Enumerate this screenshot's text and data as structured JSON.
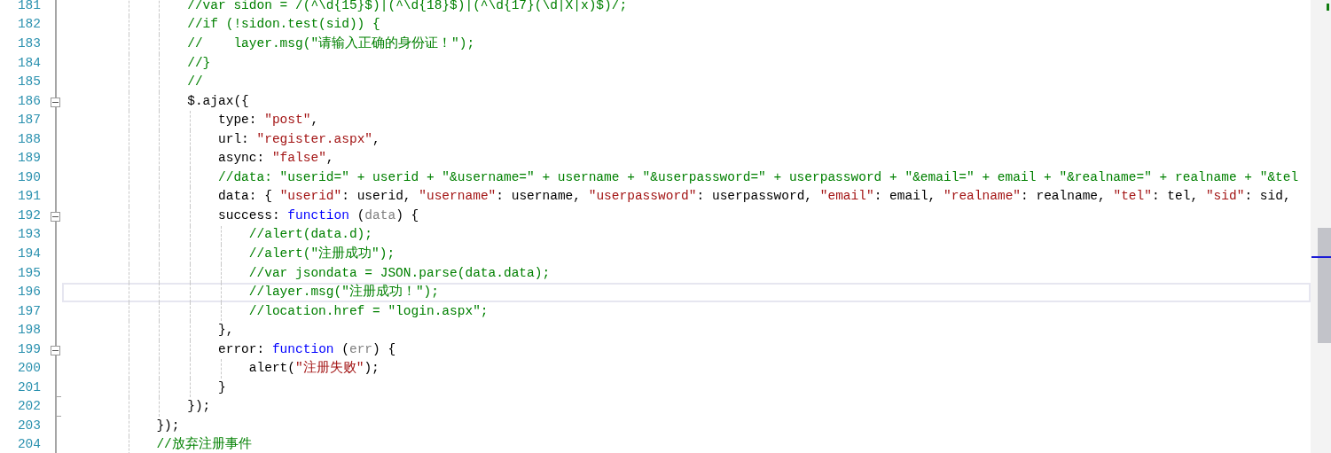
{
  "editor": {
    "lines": [
      {
        "number": "181",
        "current": false,
        "tokens": [
          {
            "kind": "comment",
            "text": "                //var sidon = /(^\\d{15}$)|(^\\d{18}$)|(^\\d{17}(\\d|X|x)$)/;"
          }
        ]
      },
      {
        "number": "182",
        "current": false,
        "tokens": [
          {
            "kind": "comment",
            "text": "                //if (!sidon.test(sid)) {"
          }
        ]
      },
      {
        "number": "183",
        "current": false,
        "tokens": [
          {
            "kind": "comment",
            "text": "                //    layer.msg(\"请输入正确的身份证！\");"
          }
        ]
      },
      {
        "number": "184",
        "current": false,
        "tokens": [
          {
            "kind": "comment",
            "text": "                //}"
          }
        ]
      },
      {
        "number": "185",
        "current": false,
        "tokens": [
          {
            "kind": "comment",
            "text": "                //"
          }
        ]
      },
      {
        "number": "186",
        "collapsible": true,
        "current": false,
        "tokens": [
          {
            "kind": "plain",
            "text": "                $.ajax({"
          }
        ]
      },
      {
        "number": "187",
        "current": false,
        "tokens": [
          {
            "kind": "plain",
            "text": "                    type: "
          },
          {
            "kind": "string",
            "text": "\"post\""
          },
          {
            "kind": "plain",
            "text": ","
          }
        ]
      },
      {
        "number": "188",
        "current": false,
        "tokens": [
          {
            "kind": "plain",
            "text": "                    url: "
          },
          {
            "kind": "string",
            "text": "\"register.aspx\""
          },
          {
            "kind": "plain",
            "text": ","
          }
        ]
      },
      {
        "number": "189",
        "current": false,
        "tokens": [
          {
            "kind": "plain",
            "text": "                    async: "
          },
          {
            "kind": "string",
            "text": "\"false\""
          },
          {
            "kind": "plain",
            "text": ","
          }
        ]
      },
      {
        "number": "190",
        "current": false,
        "tokens": [
          {
            "kind": "comment",
            "text": "                    //data: \"userid=\" + userid + \"&username=\" + username + \"&userpassword=\" + userpassword + \"&email=\" + email + \"&realname=\" + realname + \"&tel"
          }
        ]
      },
      {
        "number": "191",
        "current": false,
        "tokens": [
          {
            "kind": "plain",
            "text": "                    data: { "
          },
          {
            "kind": "string",
            "text": "\"userid\""
          },
          {
            "kind": "plain",
            "text": ": userid, "
          },
          {
            "kind": "string",
            "text": "\"username\""
          },
          {
            "kind": "plain",
            "text": ": username, "
          },
          {
            "kind": "string",
            "text": "\"userpassword\""
          },
          {
            "kind": "plain",
            "text": ": userpassword, "
          },
          {
            "kind": "string",
            "text": "\"email\""
          },
          {
            "kind": "plain",
            "text": ": email, "
          },
          {
            "kind": "string",
            "text": "\"realname\""
          },
          {
            "kind": "plain",
            "text": ": realname, "
          },
          {
            "kind": "string",
            "text": "\"tel\""
          },
          {
            "kind": "plain",
            "text": ": tel, "
          },
          {
            "kind": "string",
            "text": "\"sid\""
          },
          {
            "kind": "plain",
            "text": ": sid,"
          }
        ]
      },
      {
        "number": "192",
        "collapsible": true,
        "current": false,
        "tokens": [
          {
            "kind": "plain",
            "text": "                    success: "
          },
          {
            "kind": "keyword",
            "text": "function"
          },
          {
            "kind": "plain",
            "text": " ("
          },
          {
            "kind": "param",
            "text": "data"
          },
          {
            "kind": "plain",
            "text": ") {"
          }
        ]
      },
      {
        "number": "193",
        "current": false,
        "tokens": [
          {
            "kind": "comment",
            "text": "                        //alert(data.d);"
          }
        ]
      },
      {
        "number": "194",
        "current": false,
        "tokens": [
          {
            "kind": "comment",
            "text": "                        //alert(\"注册成功\");"
          }
        ]
      },
      {
        "number": "195",
        "current": false,
        "tokens": [
          {
            "kind": "comment",
            "text": "                        //var jsondata = JSON.parse(data.data);"
          }
        ]
      },
      {
        "number": "196",
        "current": true,
        "tokens": [
          {
            "kind": "comment",
            "text": "                        //layer.msg(\"注册成功！\");"
          }
        ]
      },
      {
        "number": "197",
        "current": false,
        "tokens": [
          {
            "kind": "comment",
            "text": "                        //location.href = \"login.aspx\";"
          }
        ]
      },
      {
        "number": "198",
        "current": false,
        "tokens": [
          {
            "kind": "plain",
            "text": "                    },"
          }
        ]
      },
      {
        "number": "199",
        "collapsible": true,
        "current": false,
        "tokens": [
          {
            "kind": "plain",
            "text": "                    error: "
          },
          {
            "kind": "keyword",
            "text": "function"
          },
          {
            "kind": "plain",
            "text": " ("
          },
          {
            "kind": "param",
            "text": "err"
          },
          {
            "kind": "plain",
            "text": ") {"
          }
        ]
      },
      {
        "number": "200",
        "current": false,
        "tokens": [
          {
            "kind": "plain",
            "text": "                        alert("
          },
          {
            "kind": "string",
            "text": "\"注册失败\""
          },
          {
            "kind": "plain",
            "text": ");"
          }
        ]
      },
      {
        "number": "201",
        "block_end": true,
        "current": false,
        "tokens": [
          {
            "kind": "plain",
            "text": "                    }"
          }
        ]
      },
      {
        "number": "202",
        "block_end": true,
        "current": false,
        "tokens": [
          {
            "kind": "plain",
            "text": "                });"
          }
        ]
      },
      {
        "number": "203",
        "current": false,
        "tokens": [
          {
            "kind": "plain",
            "text": "            });"
          }
        ]
      },
      {
        "number": "204",
        "current": false,
        "tokens": [
          {
            "kind": "comment",
            "text": "            //放弃注册事件"
          }
        ]
      }
    ]
  }
}
